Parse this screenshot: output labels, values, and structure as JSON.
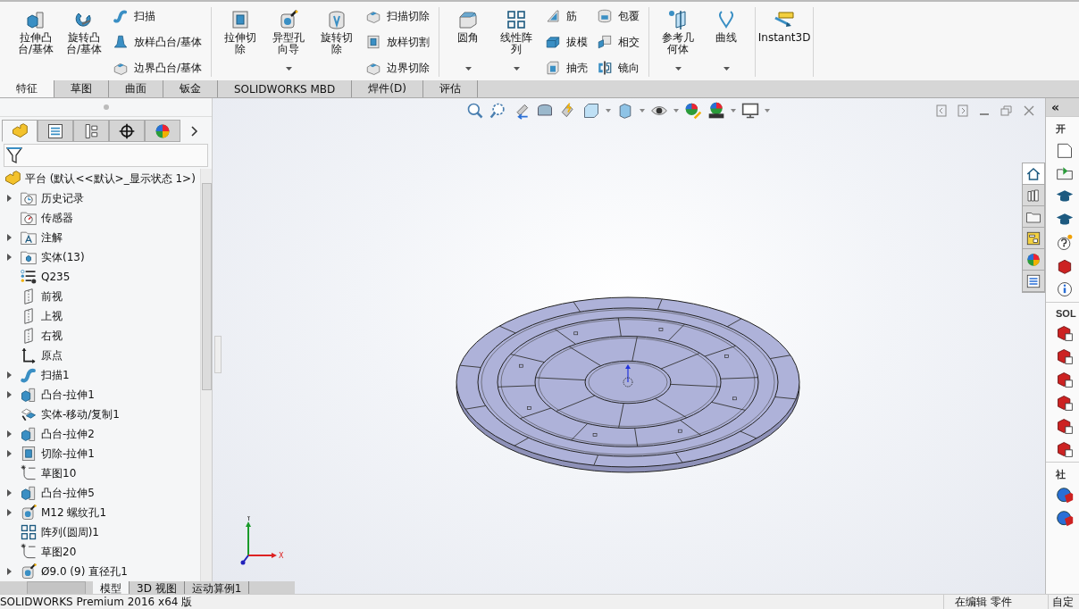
{
  "ribbon": {
    "groups": [
      {
        "items": [
          {
            "kind": "large",
            "label": [
              "拉伸凸",
              "台/基体"
            ],
            "dropdown": false
          },
          {
            "kind": "large",
            "label": [
              "旋转凸",
              "台/基体"
            ],
            "dropdown": false
          },
          {
            "kind": "stack",
            "entries": [
              "扫描",
              "放样凸台/基体",
              "边界凸台/基体"
            ]
          }
        ]
      },
      {
        "items": [
          {
            "kind": "large",
            "label": [
              "拉伸切",
              "除"
            ],
            "dropdown": false
          },
          {
            "kind": "large",
            "label": [
              "异型孔",
              "向导"
            ],
            "dropdown": true
          },
          {
            "kind": "large",
            "label": [
              "旋转切",
              "除"
            ],
            "dropdown": false
          },
          {
            "kind": "stack",
            "entries": [
              "扫描切除",
              "放样切割",
              "边界切除"
            ]
          }
        ]
      },
      {
        "items": [
          {
            "kind": "large",
            "label": [
              "圆角"
            ],
            "dropdown": true
          },
          {
            "kind": "large",
            "label": [
              "线性阵",
              "列"
            ],
            "dropdown": true
          },
          {
            "kind": "stack",
            "entries": [
              "筋",
              "拔模",
              "抽壳"
            ]
          },
          {
            "kind": "stack",
            "entries": [
              "包覆",
              "相交",
              "镜向"
            ]
          }
        ]
      },
      {
        "items": [
          {
            "kind": "large",
            "label": [
              "参考几",
              "何体"
            ],
            "dropdown": true
          },
          {
            "kind": "large",
            "label": [
              "曲线"
            ],
            "dropdown": true
          }
        ]
      },
      {
        "items": [
          {
            "kind": "large",
            "label": [
              "Instant3D"
            ],
            "dropdown": false
          }
        ]
      }
    ]
  },
  "tabs": [
    {
      "label": "特征",
      "selected": true
    },
    {
      "label": "草图",
      "selected": false
    },
    {
      "label": "曲面",
      "selected": false
    },
    {
      "label": "钣金",
      "selected": false
    },
    {
      "label": "SOLIDWORKS MBD",
      "selected": false
    },
    {
      "label": "焊件(D)",
      "selected": false
    },
    {
      "label": "评估",
      "selected": false
    }
  ],
  "feature_manager": {
    "tabs": [
      {
        "selected": true
      },
      {
        "selected": false
      },
      {
        "selected": false
      },
      {
        "selected": false
      },
      {
        "selected": false
      }
    ],
    "root": "平台  (默认<<默认>_显示状态 1>)",
    "items": [
      {
        "kind": "history",
        "label": "历史记录",
        "expandable": true
      },
      {
        "kind": "sensors",
        "label": "传感器",
        "expandable": false
      },
      {
        "kind": "annotations",
        "label": "注解",
        "expandable": true
      },
      {
        "kind": "solids",
        "label": "实体(13)",
        "expandable": true
      },
      {
        "kind": "material",
        "label": "Q235",
        "expandable": false
      },
      {
        "kind": "plane",
        "label": "前视",
        "expandable": false
      },
      {
        "kind": "plane",
        "label": "上视",
        "expandable": false
      },
      {
        "kind": "plane",
        "label": "右视",
        "expandable": false
      },
      {
        "kind": "origin",
        "label": "原点",
        "expandable": false
      },
      {
        "kind": "sweep",
        "label": "扫描1",
        "expandable": true
      },
      {
        "kind": "boss",
        "label": "凸台-拉伸1",
        "expandable": true
      },
      {
        "kind": "move",
        "label": "实体-移动/复制1",
        "expandable": false
      },
      {
        "kind": "boss",
        "label": "凸台-拉伸2",
        "expandable": true
      },
      {
        "kind": "cut",
        "label": "切除-拉伸1",
        "expandable": true
      },
      {
        "kind": "sketch",
        "label": "草图10",
        "expandable": false
      },
      {
        "kind": "boss",
        "label": "凸台-拉伸5",
        "expandable": true
      },
      {
        "kind": "hole",
        "label": "M12 螺纹孔1",
        "expandable": true
      },
      {
        "kind": "pattern",
        "label": "阵列(圆周)1",
        "expandable": false
      },
      {
        "kind": "sketch",
        "label": "草图20",
        "expandable": false
      },
      {
        "kind": "hole",
        "label": "Ø9.0 (9) 直径孔1",
        "expandable": true
      }
    ],
    "bottom_tabs": [
      {
        "label": "模型",
        "selected": true
      },
      {
        "label": "3D 视图",
        "selected": false
      },
      {
        "label": "运动算例1",
        "selected": false
      }
    ]
  },
  "viewport": {
    "triad": {
      "y_label": "Y",
      "x_label": "X"
    }
  },
  "task_pane": {
    "collapse": "«",
    "tabs": [
      {
        "selected": true
      },
      {
        "selected": false
      },
      {
        "selected": false
      },
      {
        "selected": false
      },
      {
        "selected": false
      },
      {
        "selected": false
      }
    ],
    "sections": [
      {
        "heading": "开"
      },
      {
        "heading": "SOL"
      },
      {
        "heading": "社"
      }
    ]
  },
  "status_bar": {
    "product": "SOLIDWORKS Premium 2016 x64 版",
    "mode": "在编辑 零件",
    "customize": "自定"
  }
}
